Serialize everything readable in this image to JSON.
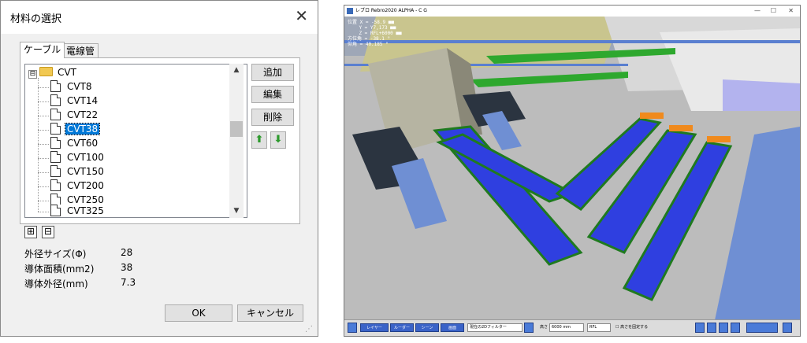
{
  "dialog": {
    "title": "材料の選択",
    "close_glyph": "✕",
    "tabs": [
      {
        "label": "ケーブル"
      },
      {
        "label": "電線管"
      }
    ],
    "tree": {
      "root": {
        "label": "CVT",
        "expander": "⊟"
      },
      "items": [
        {
          "label": "CVT8"
        },
        {
          "label": "CVT14"
        },
        {
          "label": "CVT22"
        },
        {
          "label": "CVT38",
          "selected": true
        },
        {
          "label": "CVT60"
        },
        {
          "label": "CVT100"
        },
        {
          "label": "CVT150"
        },
        {
          "label": "CVT200"
        },
        {
          "label": "CVT250"
        },
        {
          "label": "CVT325"
        }
      ],
      "scroll_up": "▲",
      "scroll_down": "▼"
    },
    "side_buttons": {
      "add": "追加",
      "edit": "編集",
      "delete": "削除",
      "up": "⬆",
      "down": "⬇"
    },
    "expand_all": "⊞",
    "collapse_all": "⊟",
    "properties": [
      {
        "label": "外径サイズ(Φ)",
        "value": "28"
      },
      {
        "label": "導体面積(mm2)",
        "value": "38"
      },
      {
        "label": "導体外径(mm)",
        "value": "7.3"
      }
    ],
    "ok_label": "OK",
    "cancel_label": "キャンセル"
  },
  "cad_window": {
    "title": "レブロ Rebro2020 ALPHA - C G",
    "controls": {
      "minimize": "—",
      "maximize": "☐",
      "close": "✕"
    },
    "readout": "位置 X = -58.9 ■■\n    Y = Y7,173 ■■\n    Z = RFL+6000 ■■\n方位角 = -38.1 °\n仰角 = 40.185 °",
    "toolbar": {
      "buttons": [
        "レイヤー",
        "ルーダー",
        "シーン",
        "画面"
      ],
      "filter_field": "現在の2Dフィルター",
      "height_label": "高さ",
      "height_value": "6000 mm",
      "level_value": "RFL",
      "fix_label": "☐ 高さを固定する"
    },
    "colors": {
      "floor": "#bcbcbc",
      "cable_tray": "#2f3fe0",
      "tray_edge": "#1f7a1f",
      "green_frame": "#2ea82e",
      "blue_structure": "#5a7fd0",
      "orange_cap": "#f08a1d"
    }
  }
}
